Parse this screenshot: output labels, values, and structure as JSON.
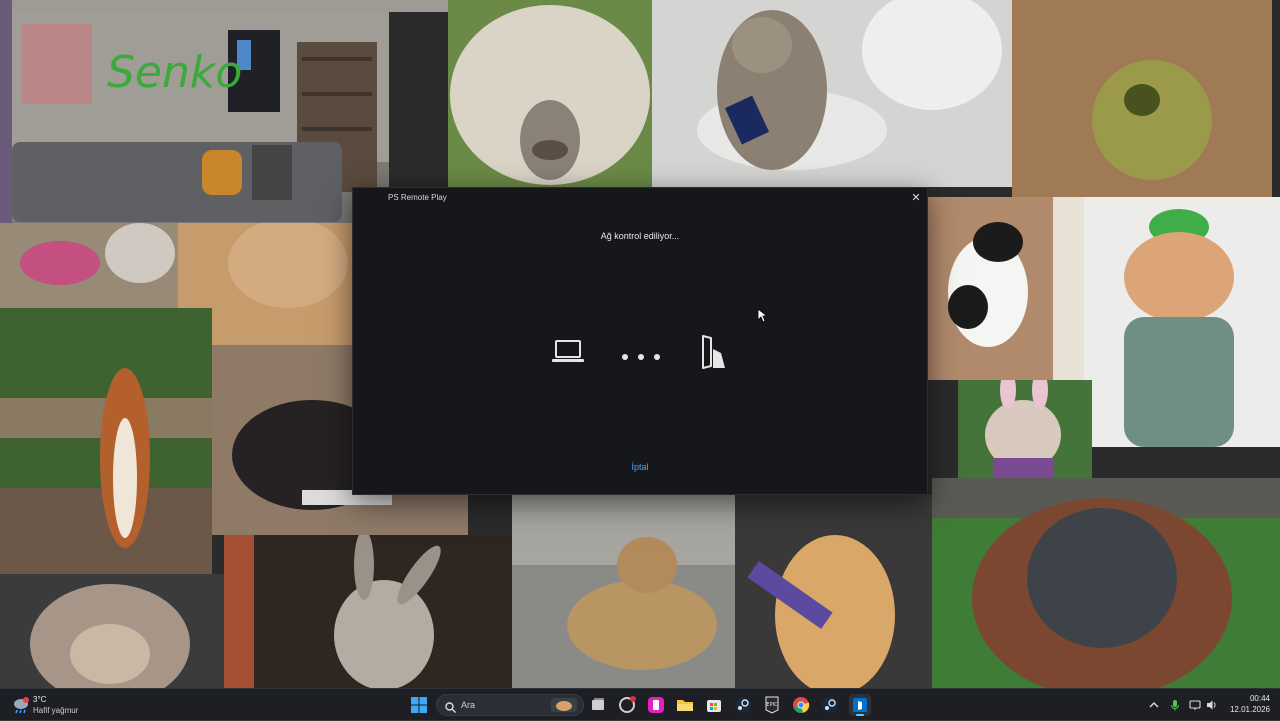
{
  "window": {
    "title": "PS Remote Play",
    "status_text": "Ağ kontrol ediliyor...",
    "cancel_label": "İptal",
    "close_glyph": "✕"
  },
  "taskbar": {
    "weather": {
      "temperature": "3°C",
      "description": "Hafif yağmur",
      "icon": "rain-cloud-icon"
    },
    "search": {
      "placeholder": "Ara"
    },
    "pinned_apps": [
      "start-icon",
      "task-view-icon",
      "app-icon",
      "media-app-icon",
      "file-explorer-icon",
      "store-icon",
      "steam-icon",
      "epic-games-icon",
      "chrome-icon",
      "steam-icon",
      "remote-play-icon"
    ],
    "clock": {
      "time": "00:44",
      "date": "12.01.2026"
    }
  },
  "colors": {
    "window_bg": "#16171b",
    "accent": "#4aa3ff",
    "taskbar_bg": "#1d1f24"
  }
}
